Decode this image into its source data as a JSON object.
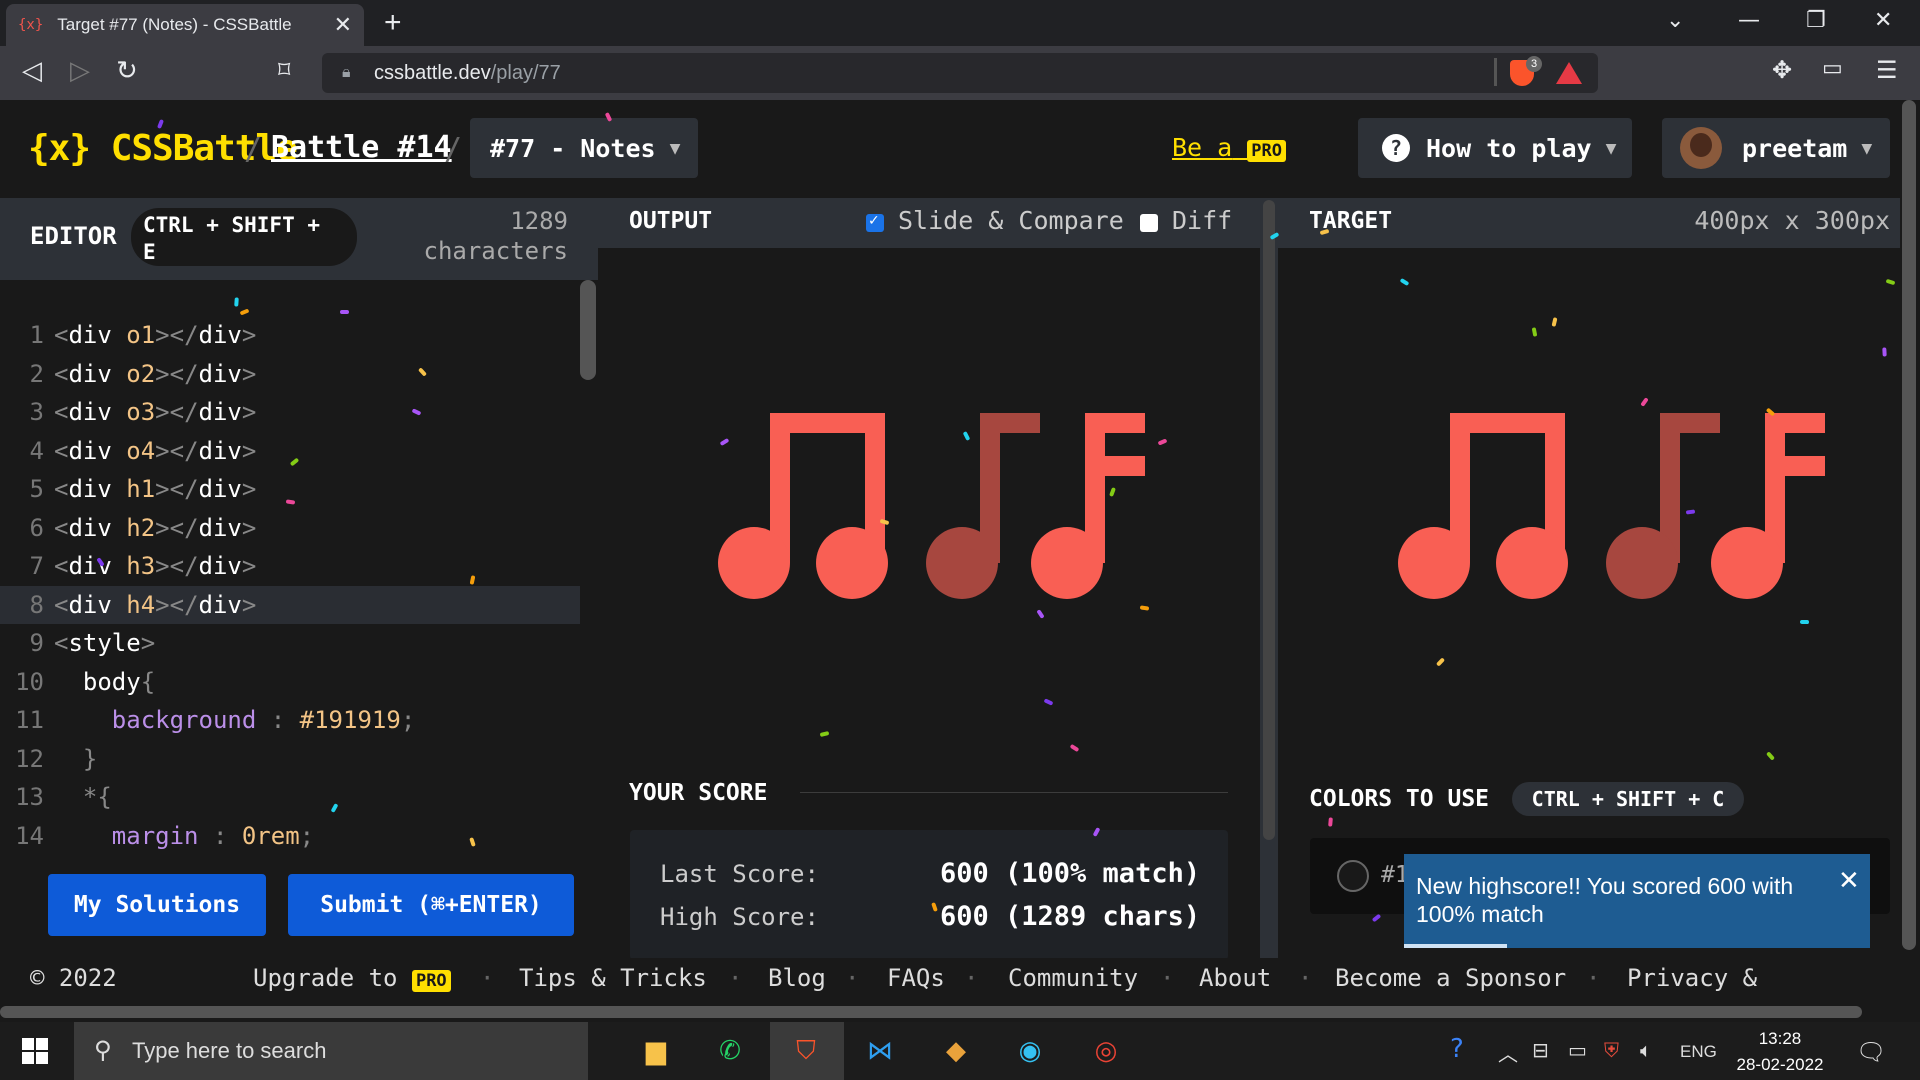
{
  "browser": {
    "tab_title": "Target #77 (Notes) - CSSBattle",
    "tab_favicon": "{x}",
    "tab_close": "✕",
    "new_tab": "+",
    "url_domain": "cssbattle.dev",
    "url_path": "/play/77",
    "brave_badge": "3"
  },
  "header": {
    "logo": "{x} CSSBattle",
    "sep": "/",
    "battle": "Battle #14",
    "target_dropdown": "#77 - Notes",
    "be_a": "Be a",
    "pro": "PRO",
    "how_to_play": "How to play",
    "help_glyph": "?",
    "username": "preetam"
  },
  "editor": {
    "label": "EDITOR",
    "shortcut": "CTRL + SHIFT + E",
    "char_count": "1289",
    "char_unit": "characters",
    "my_solutions": "My Solutions",
    "submit": "Submit (⌘+ENTER)"
  },
  "code_lines": [
    {
      "n": "1",
      "parts": [
        [
          "br",
          "<"
        ],
        [
          "tag",
          "div"
        ],
        [
          "pun",
          " "
        ],
        [
          "attr",
          "o1"
        ],
        [
          "br",
          "></"
        ],
        [
          "tag",
          "div"
        ],
        [
          "br",
          ">"
        ]
      ]
    },
    {
      "n": "2",
      "parts": [
        [
          "br",
          "<"
        ],
        [
          "tag",
          "div"
        ],
        [
          "pun",
          " "
        ],
        [
          "attr",
          "o2"
        ],
        [
          "br",
          "></"
        ],
        [
          "tag",
          "div"
        ],
        [
          "br",
          ">"
        ]
      ]
    },
    {
      "n": "3",
      "parts": [
        [
          "br",
          "<"
        ],
        [
          "tag",
          "div"
        ],
        [
          "pun",
          " "
        ],
        [
          "attr",
          "o3"
        ],
        [
          "br",
          "></"
        ],
        [
          "tag",
          "div"
        ],
        [
          "br",
          ">"
        ]
      ]
    },
    {
      "n": "4",
      "parts": [
        [
          "br",
          "<"
        ],
        [
          "tag",
          "div"
        ],
        [
          "pun",
          " "
        ],
        [
          "attr",
          "o4"
        ],
        [
          "br",
          "></"
        ],
        [
          "tag",
          "div"
        ],
        [
          "br",
          ">"
        ]
      ]
    },
    {
      "n": "5",
      "parts": [
        [
          "br",
          "<"
        ],
        [
          "tag",
          "div"
        ],
        [
          "pun",
          " "
        ],
        [
          "attr",
          "h1"
        ],
        [
          "br",
          "></"
        ],
        [
          "tag",
          "div"
        ],
        [
          "br",
          ">"
        ]
      ]
    },
    {
      "n": "6",
      "parts": [
        [
          "br",
          "<"
        ],
        [
          "tag",
          "div"
        ],
        [
          "pun",
          " "
        ],
        [
          "attr",
          "h2"
        ],
        [
          "br",
          "></"
        ],
        [
          "tag",
          "div"
        ],
        [
          "br",
          ">"
        ]
      ]
    },
    {
      "n": "7",
      "parts": [
        [
          "br",
          "<"
        ],
        [
          "tag",
          "div"
        ],
        [
          "pun",
          " "
        ],
        [
          "attr",
          "h3"
        ],
        [
          "br",
          "></"
        ],
        [
          "tag",
          "div"
        ],
        [
          "br",
          ">"
        ]
      ]
    },
    {
      "n": "8",
      "parts": [
        [
          "br",
          "<"
        ],
        [
          "tag",
          "div"
        ],
        [
          "pun",
          " "
        ],
        [
          "attr",
          "h4"
        ],
        [
          "br",
          "></"
        ],
        [
          "tag",
          "div"
        ],
        [
          "br",
          ">"
        ]
      ]
    },
    {
      "n": "9",
      "parts": [
        [
          "br",
          "<"
        ],
        [
          "tag",
          "style"
        ],
        [
          "br",
          ">"
        ]
      ]
    },
    {
      "n": "10",
      "parts": [
        [
          "pun",
          "  "
        ],
        [
          "sel",
          "body"
        ],
        [
          "pun",
          "{"
        ]
      ]
    },
    {
      "n": "11",
      "parts": [
        [
          "pun",
          "    "
        ],
        [
          "prop",
          "background"
        ],
        [
          "pun",
          " : "
        ],
        [
          "val",
          "#191919"
        ],
        [
          "pun",
          ";"
        ]
      ]
    },
    {
      "n": "12",
      "parts": [
        [
          "pun",
          "  }"
        ]
      ]
    },
    {
      "n": "13",
      "parts": [
        [
          "pun",
          "  *{"
        ]
      ]
    },
    {
      "n": "14",
      "parts": [
        [
          "pun",
          "    "
        ],
        [
          "prop",
          "margin"
        ],
        [
          "pun",
          " : "
        ],
        [
          "val",
          "0rem"
        ],
        [
          "pun",
          ";"
        ]
      ]
    }
  ],
  "output": {
    "label": "OUTPUT",
    "slide_compare": "Slide & Compare",
    "diff": "Diff",
    "slide_checked": true,
    "diff_checked": false
  },
  "score": {
    "label": "YOUR SCORE",
    "last_label": "Last Score:",
    "last_value": "600 (100% match)",
    "high_label": "High Score:",
    "high_value": "600 (1289 chars)"
  },
  "target": {
    "label": "TARGET",
    "size": "400px x 300px",
    "colors_label": "COLORS TO USE",
    "colors_shortcut": "CTRL + SHIFT + C",
    "swatch_text": "#1"
  },
  "toast": {
    "message": "New highscore!! You scored 600 with 100% match",
    "close": "✕",
    "progress": 0.22
  },
  "footer": {
    "copyright": "© 2022",
    "upgrade": "Upgrade to",
    "pro": "PRO",
    "items": [
      "Tips & Tricks",
      "Blog",
      "FAQs",
      "Community",
      "About",
      "Become a Sponsor",
      "Privacy &"
    ],
    "dot": "·"
  },
  "taskbar": {
    "search_placeholder": "Type here to search",
    "lang": "ENG",
    "time": "13:28",
    "date": "28-02-2022"
  },
  "colors": {
    "accent": "#ffdf00",
    "note_red": "#f95f54",
    "note_dark": "#a7473f",
    "button_blue": "#0e5bd8",
    "bg": "#191919"
  }
}
